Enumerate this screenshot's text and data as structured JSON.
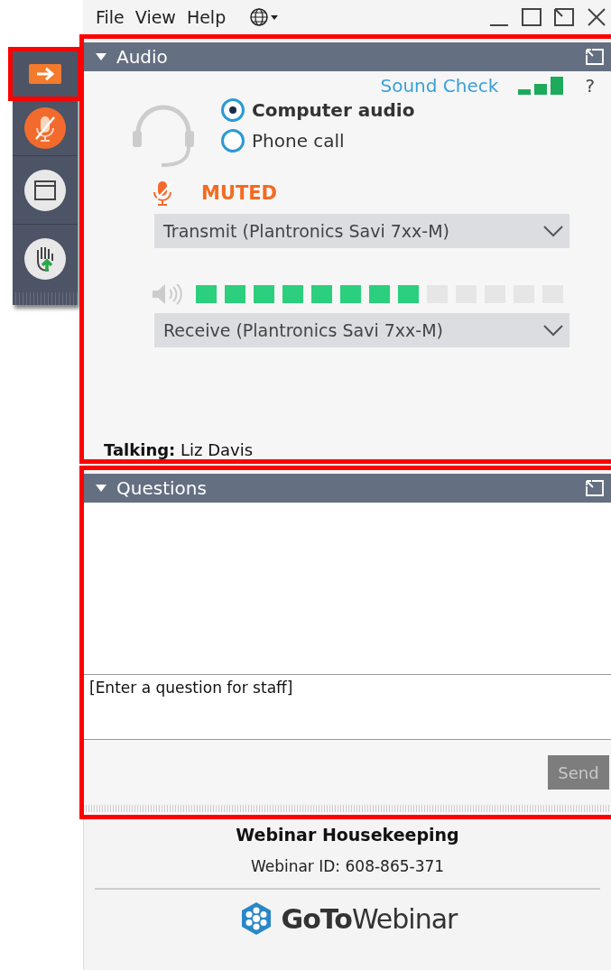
{
  "menu": [
    "File",
    "View",
    "Help"
  ],
  "audio": {
    "title": "Audio",
    "sound_check": "Sound Check",
    "help": "?",
    "options": [
      {
        "label": "Computer audio",
        "selected": true
      },
      {
        "label": "Phone call",
        "selected": false
      }
    ],
    "muted": true,
    "muted_label": "MUTED",
    "transmit": "Transmit (Plantronics Savi 7xx-M)",
    "speaker": {
      "level": 0.615
    },
    "receive": "Receive (Plantronics Savi 7xx-M)",
    "talking": "**Talking:** Liz Davis"
  },
  "questions": {
    "title": "Questions",
    "placeholder": "[Enter a question for staff]",
    "send": "Send"
  },
  "footer": {
    "title": "Webinar Housekeeping",
    "webinar_id": "Webinar ID: 608-865-371",
    "logo": "**GoTo**Webinar"
  }
}
